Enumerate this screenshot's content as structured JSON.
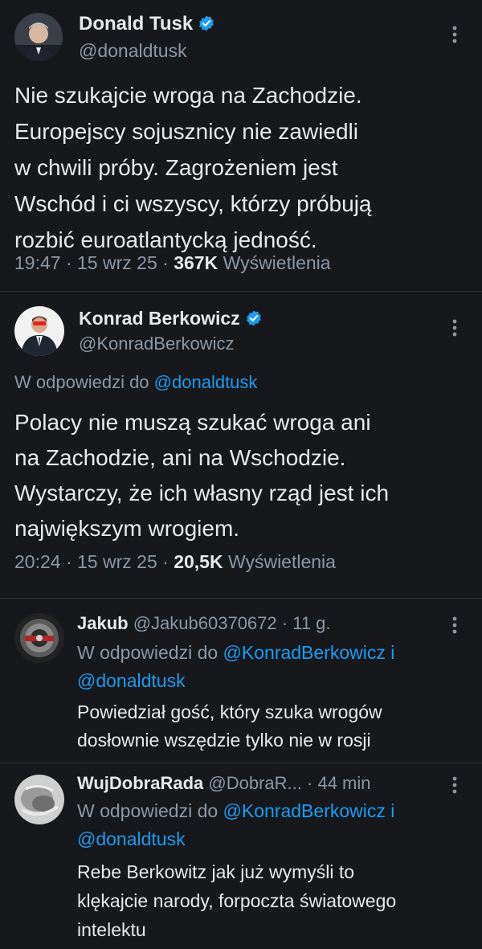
{
  "tweets": [
    {
      "name": "Donald Tusk",
      "handle": "@donaldtusk",
      "lines": [
        "Nie szukajcie wroga na Zachodzie.",
        "Europejscy sojusznicy nie zawiedli",
        "w chwili próby. Zagrożeniem jest",
        "Wschód i ci wszyscy, którzy próbują",
        "rozbić euroatlantycką jedność."
      ],
      "time": "19:47",
      "date": "15 wrz 25",
      "views": "367K",
      "views_label": "Wyświetlenia"
    },
    {
      "name": "Konrad Berkowicz",
      "handle": "@KonradBerkowicz",
      "reply_prefix": "W odpowiedzi do",
      "reply_to": "@donaldtusk",
      "lines": [
        "Polacy nie muszą szukać wroga ani",
        "na Zachodzie, ani na Wschodzie.",
        "Wystarczy, że ich własny rząd jest ich",
        "największym wrogiem."
      ],
      "time": "20:24",
      "date": "15 wrz 25",
      "views": "20,5K",
      "views_label": "Wyświetlenia"
    }
  ],
  "replies": [
    {
      "name": "Jakub",
      "handle": "@Jakub60370672",
      "age": "11 g.",
      "reply_prefix": "W odpowiedzi do",
      "reply_to_1": "@KonradBerkowicz",
      "reply_and": "i",
      "reply_to_2": "@donaldtusk",
      "lines": [
        "Powiedział gość, który szuka wrogów",
        "dosłownie wszędzie tylko nie w rosji"
      ]
    },
    {
      "name": "WujDobraRada",
      "handle": "@DobraR...",
      "age": "44 min",
      "reply_prefix": "W odpowiedzi do",
      "reply_to_1": "@KonradBerkowicz",
      "reply_and": "i",
      "reply_to_2": "@donaldtusk",
      "lines": [
        "Rebe Berkowitz jak już wymyśli to",
        "klękajcie narody, forpoczta światowego",
        "intelektu"
      ]
    }
  ],
  "colors": {
    "background": "#16181c",
    "text": "#e7e9ea",
    "muted": "#8b98a5",
    "link": "#1d9bf0",
    "verified": "#1d9bf0"
  },
  "icons": {
    "verified": "verified-badge-icon",
    "more": "more-options-icon"
  }
}
